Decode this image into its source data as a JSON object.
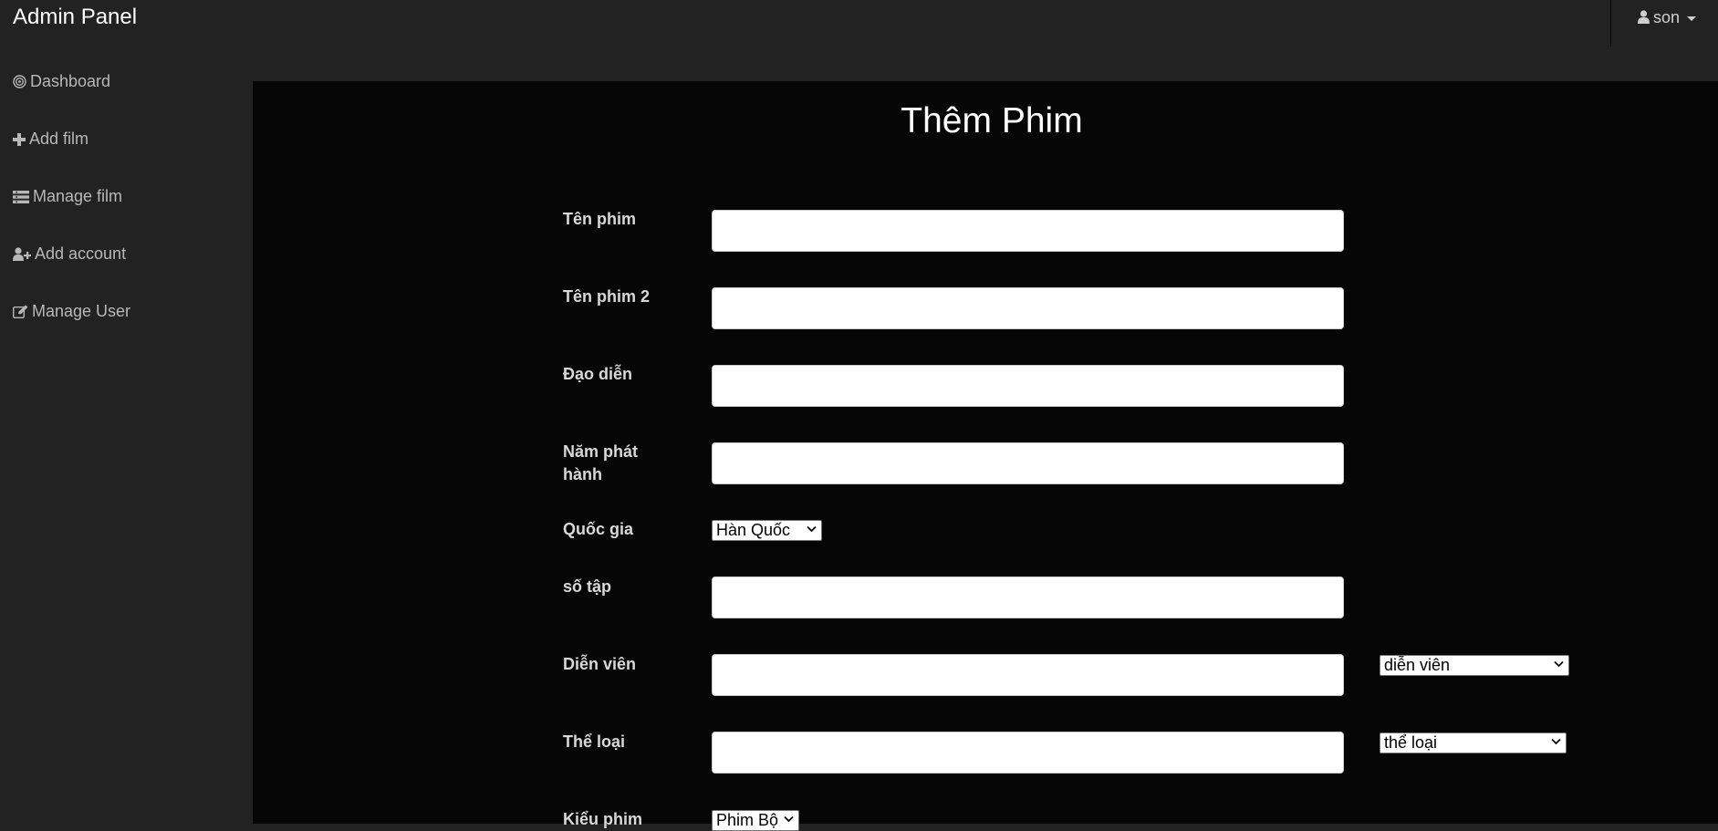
{
  "header": {
    "brand": "Admin Panel",
    "user_name": "son"
  },
  "sidebar": {
    "items": [
      {
        "label": "Dashboard"
      },
      {
        "label": "Add film"
      },
      {
        "label": "Manage film"
      },
      {
        "label": "Add account"
      },
      {
        "label": "Manage User"
      }
    ]
  },
  "form": {
    "title": "Thêm Phim",
    "labels": {
      "ten_phim": "Tên phim",
      "ten_phim_2": "Tên phim 2",
      "dao_dien": "Đạo diễn",
      "nam_phat_hanh": "Năm phát hành",
      "quoc_gia": "Quốc gia",
      "so_tap": "số tập",
      "dien_vien": "Diễn viên",
      "the_loai": "Thể loại",
      "kieu_phim": "Kiểu phim"
    },
    "values": {
      "ten_phim": "",
      "ten_phim_2": "",
      "dao_dien": "",
      "nam_phat_hanh": "",
      "so_tap": "",
      "dien_vien": "",
      "the_loai": ""
    },
    "selects": {
      "quoc_gia": "Hàn Quốc",
      "dien_vien": "diễn viên",
      "the_loai": "thể loại",
      "kieu_phim": "Phim Bộ"
    }
  }
}
